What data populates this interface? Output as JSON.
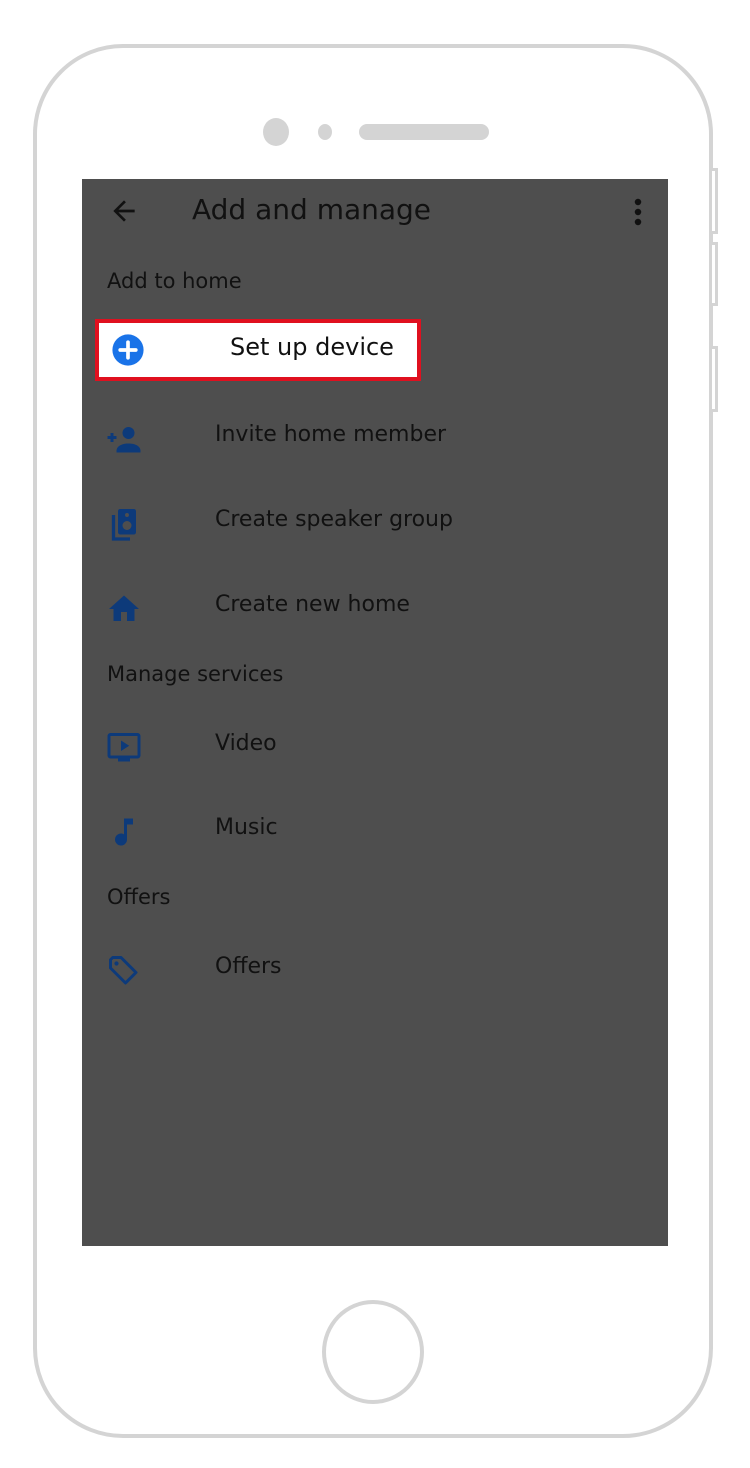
{
  "appbar": {
    "title": "Add and manage",
    "back_icon": "arrow-back-icon",
    "more_icon": "more-vert-icon"
  },
  "sections": [
    {
      "header": "Add to home",
      "items": [
        {
          "label": "Set up device",
          "icon": "add-circle-icon",
          "highlighted": true
        },
        {
          "label": "Invite home member",
          "icon": "person-add-icon"
        },
        {
          "label": "Create speaker group",
          "icon": "speaker-group-icon"
        },
        {
          "label": "Create new home",
          "icon": "home-icon"
        }
      ]
    },
    {
      "header": "Manage services",
      "items": [
        {
          "label": "Video",
          "icon": "tv-play-icon"
        },
        {
          "label": "Music",
          "icon": "music-note-icon"
        }
      ]
    },
    {
      "header": "Offers",
      "items": [
        {
          "label": "Offers",
          "icon": "tag-icon"
        }
      ]
    }
  ],
  "colors": {
    "highlight_border": "#e0101f",
    "accent_blue": "#1a73e8",
    "icon_dark_blue": "#0d3a7a",
    "overlay": "#4e4e4e"
  }
}
